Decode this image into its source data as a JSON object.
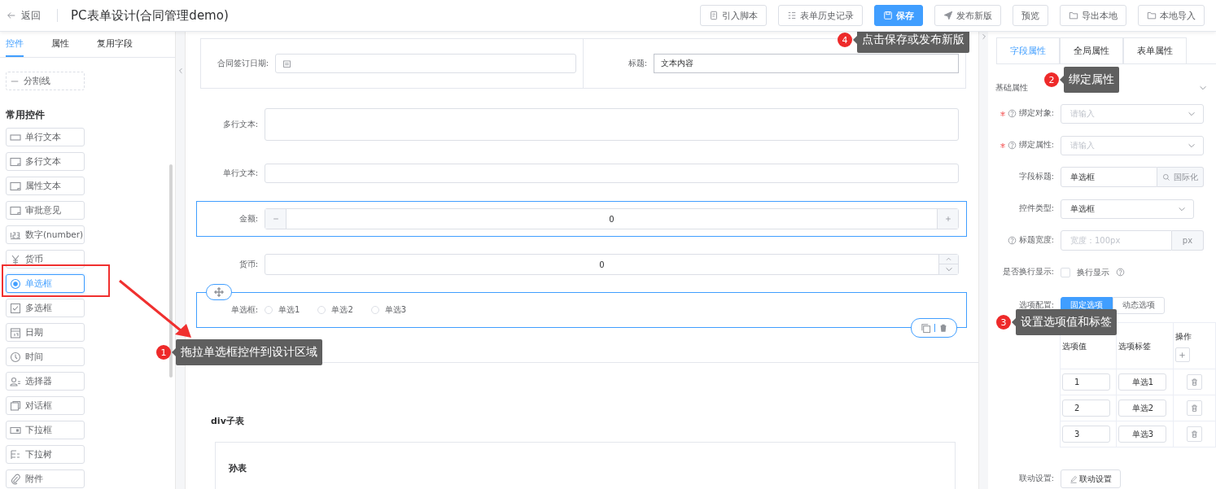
{
  "header": {
    "back": "返回",
    "title": "PC表单设计(合同管理demo)",
    "buttons": [
      {
        "label": "引入脚本",
        "primary": false
      },
      {
        "label": "表单历史记录",
        "primary": false
      },
      {
        "label": "保存",
        "primary": true
      },
      {
        "label": "发布新版",
        "primary": false
      },
      {
        "label": "预览",
        "primary": false
      },
      {
        "label": "导出本地",
        "primary": false
      },
      {
        "label": "本地导入",
        "primary": false
      }
    ]
  },
  "left_panel": {
    "tabs": [
      {
        "label": "控件",
        "selected": true
      },
      {
        "label": "属性",
        "selected": false
      },
      {
        "label": "复用字段",
        "selected": false
      }
    ],
    "divider_item": "分割线",
    "section_title": "常用控件",
    "items": [
      {
        "label": "单行文本",
        "selected": false
      },
      {
        "label": "多行文本",
        "selected": false
      },
      {
        "label": "属性文本",
        "selected": false
      },
      {
        "label": "审批意见",
        "selected": false
      },
      {
        "label": "数字(number)",
        "selected": false
      },
      {
        "label": "货币",
        "selected": false
      },
      {
        "label": "单选框",
        "selected": true
      },
      {
        "label": "多选框",
        "selected": false
      },
      {
        "label": "日期",
        "selected": false
      },
      {
        "label": "时间",
        "selected": false
      },
      {
        "label": "选择器",
        "selected": false
      },
      {
        "label": "对话框",
        "selected": false
      },
      {
        "label": "下拉框",
        "selected": false
      },
      {
        "label": "下拉树",
        "selected": false
      },
      {
        "label": "附件",
        "selected": false
      }
    ]
  },
  "canvas": {
    "top_row": [
      {
        "label": "合同签订日期:",
        "kind": "date"
      },
      {
        "label": "标题:",
        "kind": "text",
        "value": "文本内容"
      }
    ],
    "fields": [
      {
        "label": "多行文本:",
        "kind": "textarea",
        "selected": false
      },
      {
        "label": "单行文本:",
        "kind": "input",
        "selected": false
      },
      {
        "label": "金额:",
        "kind": "stepper",
        "value": "0",
        "selected": true
      },
      {
        "label": "货币:",
        "kind": "spinner",
        "value": "0",
        "selected": false
      },
      {
        "label": "单选框:",
        "kind": "radio",
        "selected": true,
        "options": [
          {
            "label": "单选1",
            "checked": false
          },
          {
            "label": "单选2",
            "checked": false
          },
          {
            "label": "单选3",
            "checked": false
          }
        ]
      }
    ],
    "subtable": {
      "title": "div子表",
      "child_title": "孙表"
    }
  },
  "right_panel": {
    "tabs": [
      {
        "label": "字段属性",
        "selected": true
      },
      {
        "label": "全局属性",
        "selected": false
      },
      {
        "label": "表单属性",
        "selected": false
      }
    ],
    "section_title": "基础属性",
    "rows": [
      {
        "kind": "select",
        "label": "绑定对象:",
        "required": true,
        "help": true,
        "placeholder": "请输入"
      },
      {
        "kind": "select",
        "label": "绑定属性:",
        "required": true,
        "help": true,
        "placeholder": "请输入"
      },
      {
        "kind": "addon_input",
        "label": "字段标题:",
        "required": false,
        "help": false,
        "value": "单选框",
        "addon": "国际化"
      },
      {
        "kind": "select",
        "label": "控件类型:",
        "required": false,
        "help": false,
        "value": "单选框"
      },
      {
        "kind": "unit_input",
        "label": "标题宽度:",
        "required": false,
        "help": true,
        "placeholder": "宽度：100px",
        "unit": "px"
      },
      {
        "kind": "checkbox",
        "label": "是否换行显示:",
        "required": false,
        "help": false,
        "text": "换行显示",
        "checked": false
      }
    ],
    "options_config": {
      "label": "选项配置:",
      "modes": [
        {
          "label": "固定选项",
          "selected": true
        },
        {
          "label": "动态选项",
          "selected": false
        }
      ],
      "columns": [
        "选项值",
        "选项标签",
        "操作"
      ],
      "rows": [
        {
          "value": "1",
          "label": "单选1"
        },
        {
          "value": "2",
          "label": "单选2"
        },
        {
          "value": "3",
          "label": "单选3"
        }
      ]
    },
    "linkage": {
      "label": "联动设置:",
      "button": "联动设置"
    }
  },
  "callouts": [
    {
      "number": "1",
      "text": "拖拉单选框控件到设计区域"
    },
    {
      "number": "2",
      "text": "绑定属性"
    },
    {
      "number": "3",
      "text": "设置选项值和标签"
    },
    {
      "number": "4",
      "text": "点击保存或发布新版"
    }
  ]
}
